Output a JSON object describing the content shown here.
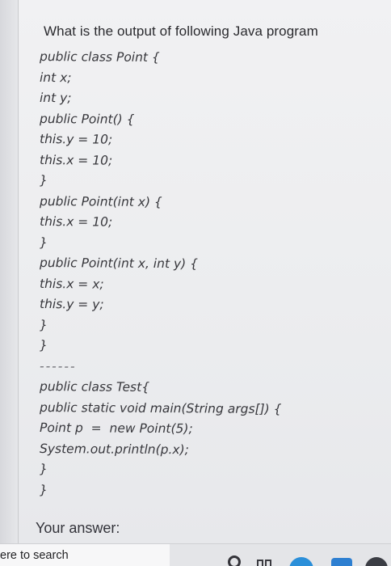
{
  "question": {
    "title": "What is the output of following Java program"
  },
  "code": {
    "lines": [
      "public class Point {",
      "int x;",
      "int y;",
      "public Point() {",
      "this.y = 10;",
      "this.x = 10;",
      "}",
      "public Point(int x) {",
      "this.x = 10;",
      "}",
      "public Point(int x, int y) {",
      "this.x = x;",
      "this.y = y;",
      "}",
      "}",
      "------",
      "public class Test{",
      "public static void main(String args[]) {",
      "Point p  =  new Point(5);",
      "System.out.println(p.x);",
      "}",
      "}"
    ]
  },
  "answer": {
    "label": "Your answer:"
  },
  "taskbar": {
    "search_text": "ere to search"
  }
}
